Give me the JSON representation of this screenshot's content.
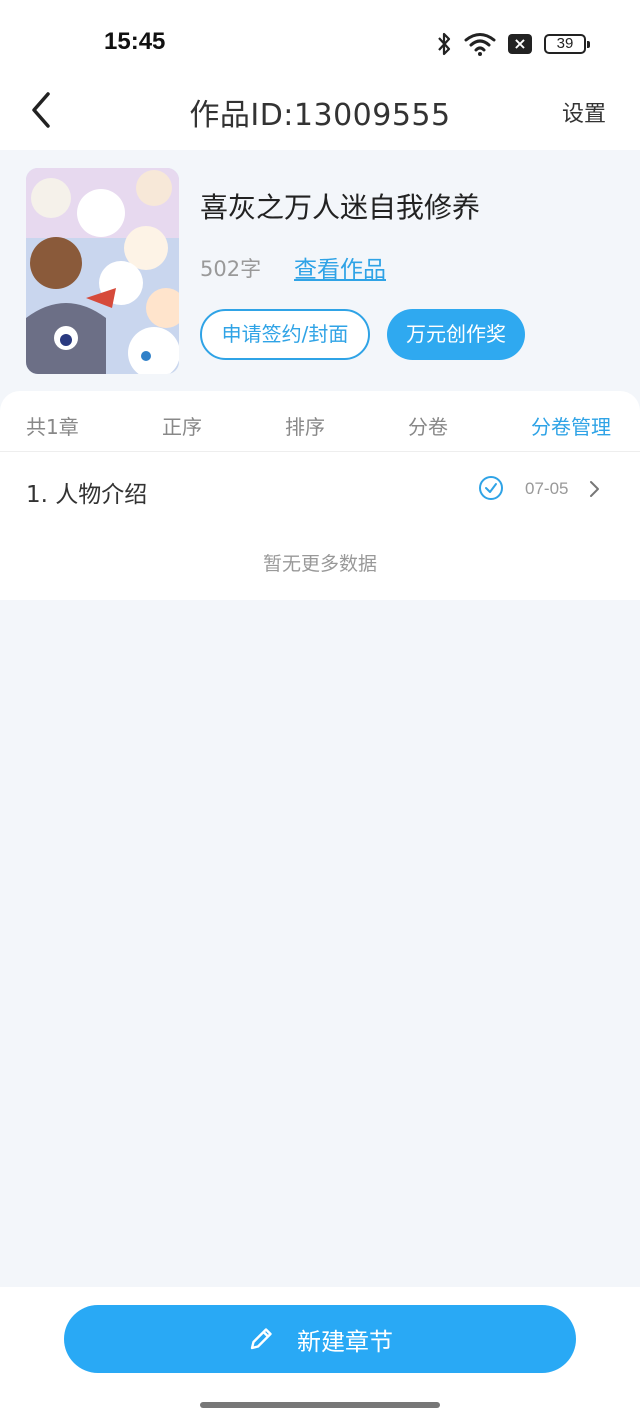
{
  "status_bar": {
    "time": "15:45",
    "battery": "39",
    "icons": [
      "bluetooth-icon",
      "wifi-icon",
      "notification-x-icon",
      "battery-icon"
    ]
  },
  "nav": {
    "title": "作品ID:13009555",
    "settings_label": "设置",
    "back_icon": "chevron-left-icon"
  },
  "book": {
    "title": "喜灰之万人迷自我修养",
    "word_count": "502字",
    "view_link": "查看作品",
    "apply_button": "申请签约/封面",
    "award_button": "万元创作奖"
  },
  "tabs": {
    "count_label": "共1章",
    "order_label": "正序",
    "sort_label": "排序",
    "volume_label": "分卷",
    "volume_manage_label": "分卷管理"
  },
  "chapters": [
    {
      "name": "1. 人物介绍",
      "date": "07-05",
      "status_icon": "check-circle-icon"
    }
  ],
  "list_footer": "暂无更多数据",
  "bottom": {
    "new_chapter_label": "新建章节",
    "icon": "pencil-icon"
  },
  "colors": {
    "accent": "#2fa3e6",
    "button_fill": "#29a9f5",
    "page_bg": "#f3f6fa"
  }
}
